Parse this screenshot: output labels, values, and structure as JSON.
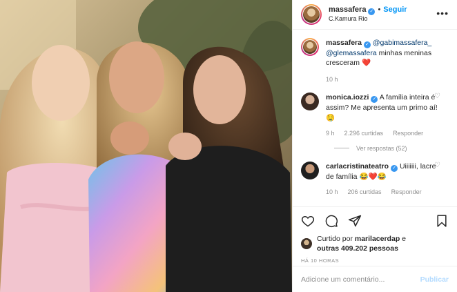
{
  "post": {
    "header": {
      "username": "massafera",
      "separator": "•",
      "follow_label": "Seguir",
      "location": "C.Kamura Rio",
      "more_label": "•••"
    },
    "caption": {
      "username": "massafera",
      "mention1": "@gabimassafera_",
      "mention2": "@glemassafera",
      "text": " minhas meninas cresceram ",
      "emoji": "❤️",
      "time": "10 h"
    },
    "comments": [
      {
        "username": "monica.iozzi",
        "text": " A família inteira é assim? Me apresenta um primo aí! 🤤",
        "time": "9 h",
        "likes": "2.296 curtidas",
        "reply": "Responder"
      },
      {
        "username": "carlacristinateatro",
        "text": " Uiiiiiii, lacre de família 😂❤️😂",
        "time": "10 h",
        "likes": "206 curtidas",
        "reply": "Responder"
      }
    ],
    "view_replies": "Ver respostas (52)",
    "likes": {
      "prefix": "Curtido por ",
      "user": "marilacerdap",
      "conj": " e",
      "others": "outras 409.202 pessoas"
    },
    "timestamp": "HÁ 10 HORAS",
    "add_comment": {
      "placeholder": "Adicione um comentário...",
      "publish": "Publicar"
    }
  },
  "icons": {
    "verified": "verified-badge-icon",
    "like": "heart-icon",
    "comment": "comment-bubble-icon",
    "share": "paper-plane-icon",
    "save": "bookmark-icon",
    "more": "more-options-icon"
  },
  "colors": {
    "accent": "#0095f6",
    "verified": "#3897f0",
    "muted": "#8e8e8e",
    "publish_disabled": "#b3dbff"
  }
}
